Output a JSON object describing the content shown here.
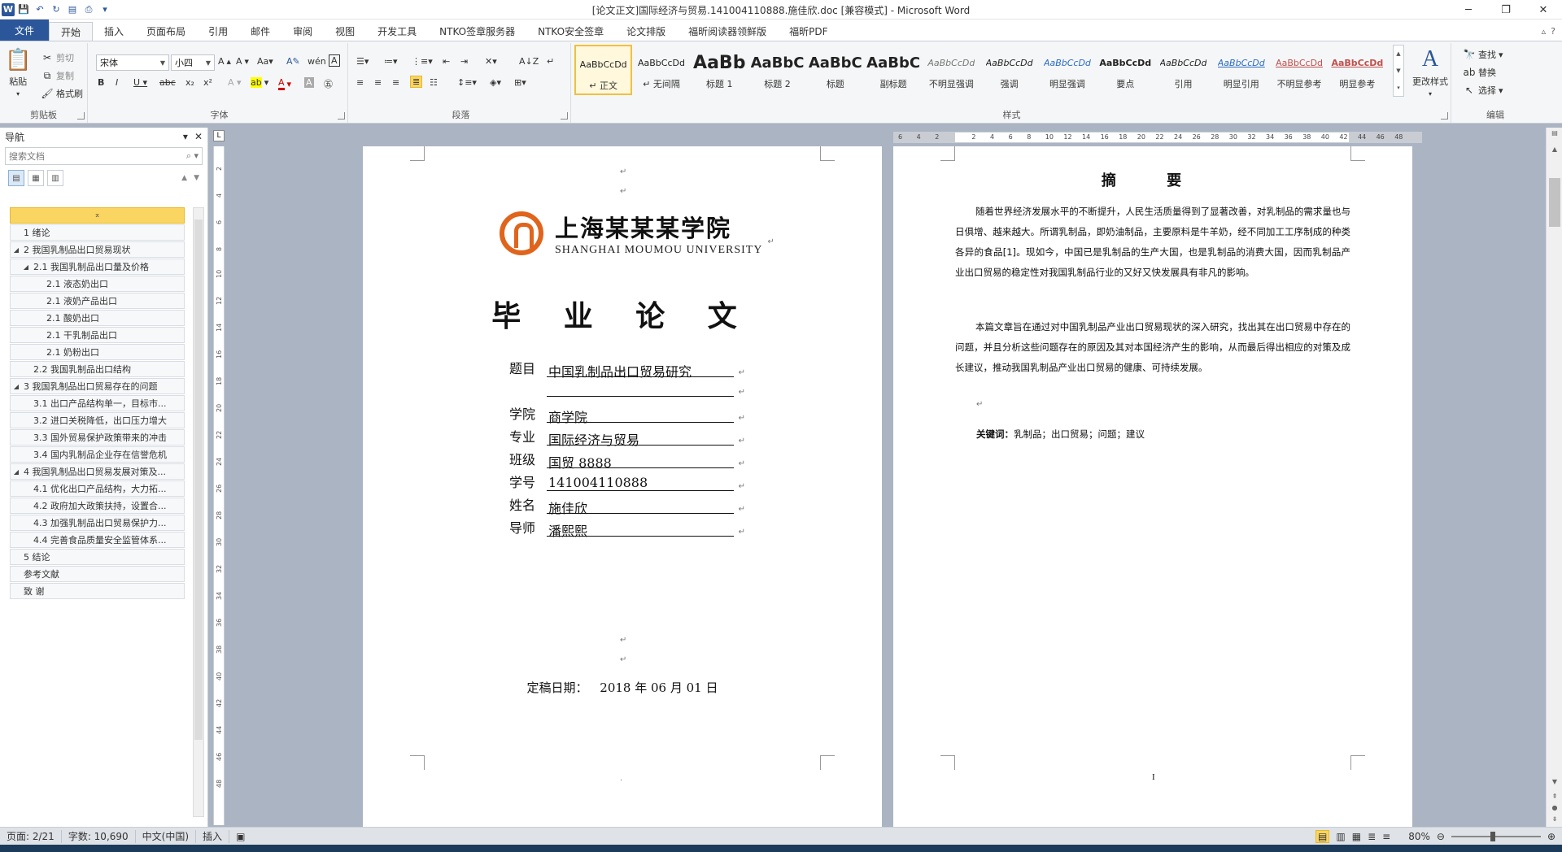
{
  "window": {
    "title": "[论文正文]国际经济与贸易.141004110888.施佳欣.doc [兼容模式] - Microsoft Word",
    "minimize": "─",
    "restore": "❐",
    "close": "✕"
  },
  "tabs": [
    "文件",
    "开始",
    "插入",
    "页面布局",
    "引用",
    "邮件",
    "审阅",
    "视图",
    "开发工具",
    "NTKO签章服务器",
    "NTKO安全签章",
    "论文排版",
    "福昕阅读器领鲜版",
    "福昕PDF"
  ],
  "ribbon": {
    "clipboard": {
      "paste": "粘贴",
      "cut": "剪切",
      "copy": "复制",
      "format_painter": "格式刷",
      "group": "剪贴板"
    },
    "font": {
      "name": "宋体",
      "size": "小四",
      "group": "字体"
    },
    "paragraph": {
      "group": "段落"
    },
    "styles": {
      "group": "样式",
      "change": "更改样式",
      "items": [
        {
          "sample": "AaBbCcDd",
          "name": "↵ 正文"
        },
        {
          "sample": "AaBbCcDd",
          "name": "↵ 无间隔"
        },
        {
          "sample": "AaBb",
          "name": "标题 1"
        },
        {
          "sample": "AaBbC",
          "name": "标题 2"
        },
        {
          "sample": "AaBbC",
          "name": "标题"
        },
        {
          "sample": "AaBbC",
          "name": "副标题"
        },
        {
          "sample": "AaBbCcDd",
          "name": "不明显强调"
        },
        {
          "sample": "AaBbCcDd",
          "name": "强调"
        },
        {
          "sample": "AaBbCcDd",
          "name": "明显强调"
        },
        {
          "sample": "AaBbCcDd",
          "name": "要点"
        },
        {
          "sample": "AaBbCcDd",
          "name": "引用"
        },
        {
          "sample": "AaBbCcDd",
          "name": "明显引用"
        },
        {
          "sample": "AaBbCcDd",
          "name": "不明显参考"
        },
        {
          "sample": "AaBbCcDd",
          "name": "明显参考"
        }
      ]
    },
    "editing": {
      "find": "查找",
      "replace": "替换",
      "select": "选择",
      "group": "编辑"
    }
  },
  "nav": {
    "title": "导航",
    "search_placeholder": "搜索文档",
    "items": [
      {
        "text": "1 绪论",
        "level": 1,
        "tri": ""
      },
      {
        "text": "2 我国乳制品出口贸易现状",
        "level": 1,
        "tri": "◢"
      },
      {
        "text": "2.1 我国乳制品出口量及价格",
        "level": 2,
        "tri": "◢"
      },
      {
        "text": "2.1 液态奶出口",
        "level": 3,
        "tri": ""
      },
      {
        "text": "2.1 液奶产品出口",
        "level": 3,
        "tri": ""
      },
      {
        "text": "2.1 酸奶出口",
        "level": 3,
        "tri": ""
      },
      {
        "text": "2.1 干乳制品出口",
        "level": 3,
        "tri": ""
      },
      {
        "text": "2.1 奶粉出口",
        "level": 3,
        "tri": ""
      },
      {
        "text": "2.2 我国乳制品出口结构",
        "level": 2,
        "tri": ""
      },
      {
        "text": "3 我国乳制品出口贸易存在的问题",
        "level": 1,
        "tri": "◢"
      },
      {
        "text": "3.1 出口产品结构单一，目标市...",
        "level": 2,
        "tri": ""
      },
      {
        "text": "3.2 进口关税降低，出口压力增大",
        "level": 2,
        "tri": ""
      },
      {
        "text": "3.3 国外贸易保护政策带来的冲击",
        "level": 2,
        "tri": ""
      },
      {
        "text": "3.4 国内乳制品企业存在信誉危机",
        "level": 2,
        "tri": ""
      },
      {
        "text": "4 我国乳制品出口贸易发展对策及...",
        "level": 1,
        "tri": "◢"
      },
      {
        "text": "4.1 优化出口产品结构，大力拓...",
        "level": 2,
        "tri": ""
      },
      {
        "text": "4.2 政府加大政策扶持，设置合...",
        "level": 2,
        "tri": ""
      },
      {
        "text": "4.3 加强乳制品出口贸易保护力...",
        "level": 2,
        "tri": ""
      },
      {
        "text": "4.4 完善食品质量安全监管体系...",
        "level": 2,
        "tri": ""
      },
      {
        "text": "5 结论",
        "level": 1,
        "tri": ""
      },
      {
        "text": "参考文献",
        "level": 1,
        "tri": ""
      },
      {
        "text": "致  谢",
        "level": 1,
        "tri": ""
      }
    ]
  },
  "ruler": {
    "h_ticks": [
      "6",
      "4",
      "2",
      "",
      "2",
      "4",
      "6",
      "8",
      "10",
      "12",
      "14",
      "16",
      "18",
      "20",
      "22",
      "24",
      "26",
      "28",
      "30",
      "32",
      "34",
      "36",
      "38",
      "40",
      "42",
      "44",
      "46",
      "48"
    ],
    "v_ticks": [
      "2",
      "4",
      "6",
      "8",
      "10",
      "12",
      "14",
      "16",
      "18",
      "20",
      "22",
      "24",
      "26",
      "28",
      "30",
      "32",
      "34",
      "36",
      "38",
      "40",
      "42",
      "44",
      "46",
      "48"
    ]
  },
  "cover": {
    "logo_cn": "上海某某某学院",
    "logo_en": "SHANGHAI MOUMOU UNIVERSITY",
    "thesis_title": "毕 业 论 文",
    "rows": [
      {
        "label": "题目",
        "value": "中国乳制品出口贸易研究"
      },
      {
        "label": "",
        "value": ""
      },
      {
        "label": "学院",
        "value": "商学院"
      },
      {
        "label": "专业",
        "value": "国际经济与贸易"
      },
      {
        "label": "班级",
        "value": "国贸 8888"
      },
      {
        "label": "学号",
        "value": "141004110888"
      },
      {
        "label": "姓名",
        "value": "施佳欣"
      },
      {
        "label": "导师",
        "value": "潘熙熙"
      }
    ],
    "date_label": "定稿日期：",
    "date_value": "2018 年 06 月 01 日"
  },
  "abstract": {
    "title": "摘  要",
    "para1": "随着世界经济发展水平的不断提升，人民生活质量得到了显著改善，对乳制品的需求量也与日俱增、越来越大。所谓乳制品，即奶油制品，主要原料是牛羊奶，经不同加工工序制成的种类各异的食品[1]。现如今，中国已是乳制品的生产大国，也是乳制品的消费大国，因而乳制品产业出口贸易的稳定性对我国乳制品行业的又好又快发展具有非凡的影响。",
    "para2": "本篇文章旨在通过对中国乳制品产业出口贸易现状的深入研究，找出其在出口贸易中存在的问题，并且分析这些问题存在的原因及其对本国经济产生的影响，从而最后得出相应的对策及成长建议，推动我国乳制品产业出口贸易的健康、可持续发展。",
    "keywords_label": "关键词：",
    "keywords": "乳制品；出口贸易；问题；建议",
    "page_number": "I"
  },
  "status": {
    "page": "页面: 2/21",
    "words": "字数: 10,690",
    "lang": "中文(中国)",
    "mode": "插入",
    "zoom": "80%"
  },
  "colors": {
    "accent": "#2b579a",
    "nav_highlight": "#fbd562",
    "logo_orange": "#e0641c"
  }
}
